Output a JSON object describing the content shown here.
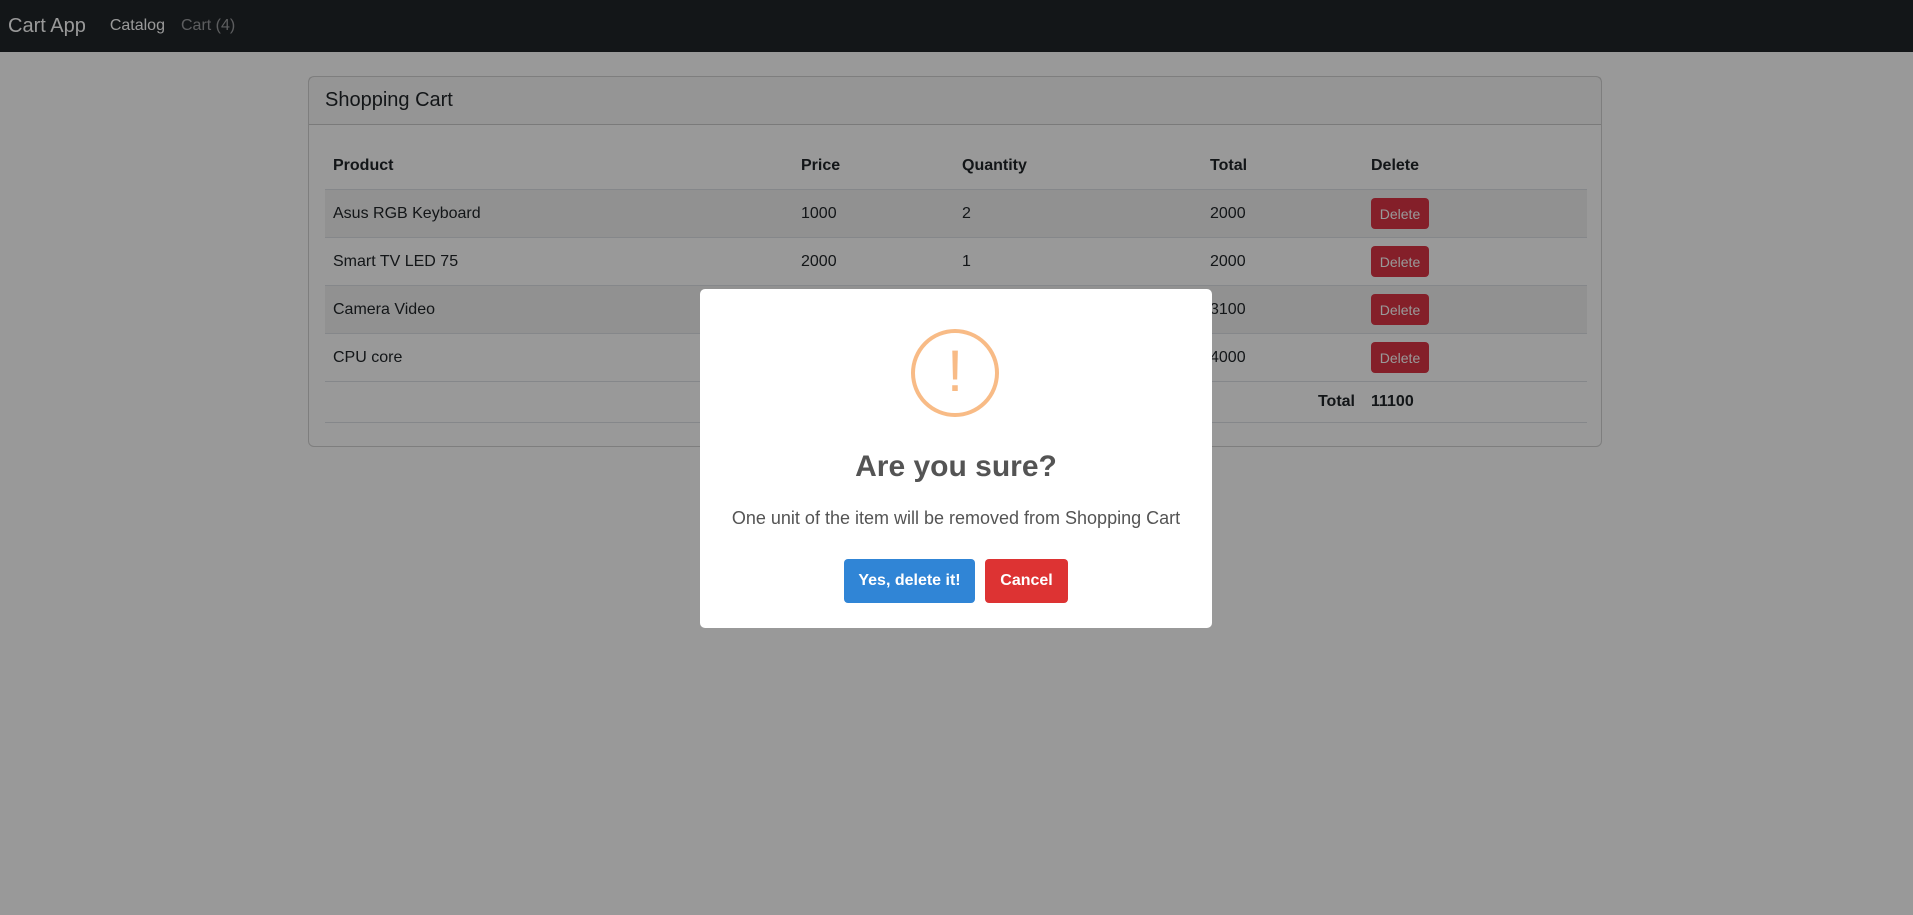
{
  "navbar": {
    "brand": "Cart App",
    "links": [
      {
        "label": "Catalog"
      },
      {
        "label": "Cart (4)"
      }
    ]
  },
  "cart": {
    "title": "Shopping Cart",
    "headers": {
      "product": "Product",
      "price": "Price",
      "quantity": "Quantity",
      "total": "Total",
      "delete": "Delete"
    },
    "rows": [
      {
        "product": "Asus RGB Keyboard",
        "price": "1000",
        "quantity": "2",
        "total": "2000",
        "delete_label": "Delete"
      },
      {
        "product": "Smart TV LED 75",
        "price": "2000",
        "quantity": "1",
        "total": "2000",
        "delete_label": "Delete"
      },
      {
        "product": "Camera Video",
        "price": "",
        "quantity": "",
        "total": "3100",
        "delete_label": "Delete"
      },
      {
        "product": "CPU core",
        "price": "",
        "quantity": "",
        "total": "4000",
        "delete_label": "Delete"
      }
    ],
    "grand_total_label": "Total",
    "grand_total_value": "11100"
  },
  "dialog": {
    "icon": "warning-icon",
    "icon_glyph": "!",
    "title": "Are you sure?",
    "text": "One unit of the item will be removed from Shopping Cart",
    "confirm_label": "Yes, delete it!",
    "cancel_label": "Cancel"
  },
  "colors": {
    "navbar": "#212529",
    "danger": "#dc3545",
    "confirm": "#3085d6",
    "cancel": "#dd3333",
    "warning": "#f8bb86"
  }
}
